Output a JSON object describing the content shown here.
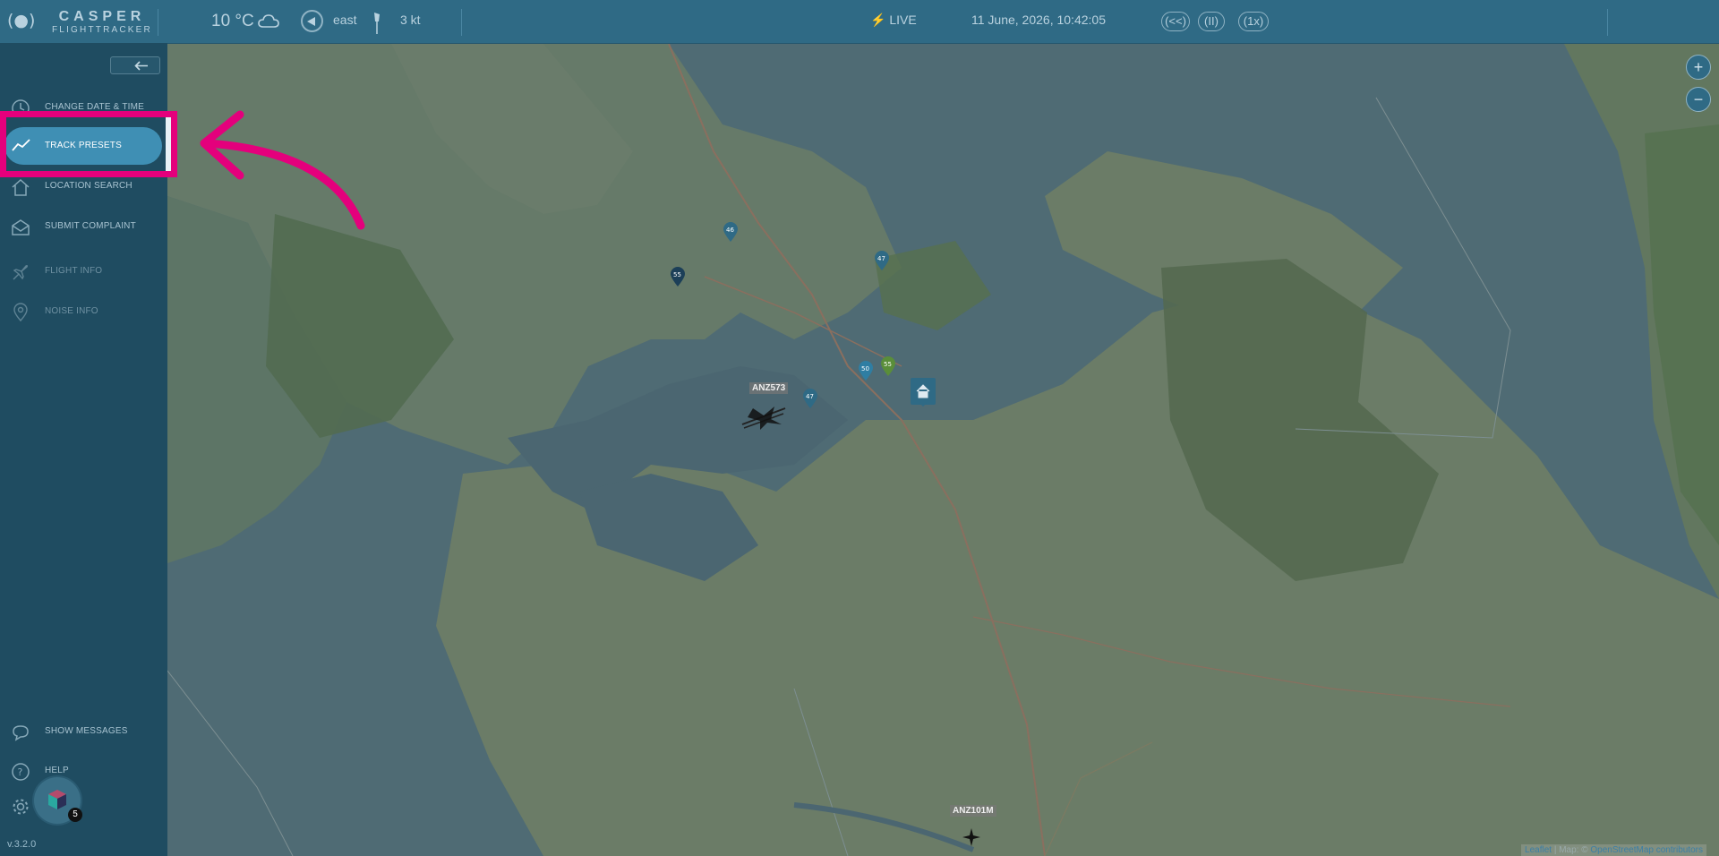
{
  "header": {
    "logo_line1": "CASPER",
    "logo_line2": "FLIGHTTRACKER",
    "temperature": "10 °C",
    "weather_icon": "cloud-icon",
    "wind_direction": "east",
    "wind_speed": "3 kt",
    "live_label": "LIVE",
    "datetime": "11 June, 2026, 10:42:05",
    "rewind_label": "(<<)",
    "pause_label": "(II)",
    "speed_label": "(1x)"
  },
  "sidebar": {
    "items": [
      {
        "label": "CHANGE DATE & TIME",
        "icon": "clock-icon"
      },
      {
        "label": "TRACK PRESETS",
        "icon": "chart-line-icon"
      },
      {
        "label": "LOCATION SEARCH",
        "icon": "home-icon"
      },
      {
        "label": "SUBMIT COMPLAINT",
        "icon": "envelope-icon"
      },
      {
        "label": "FLIGHT INFO",
        "icon": "plane-icon"
      },
      {
        "label": "NOISE INFO",
        "icon": "location-pin-icon"
      }
    ],
    "bottom_items": [
      {
        "label": "SHOW MESSAGES",
        "icon": "chat-bubble-icon"
      },
      {
        "label": "HELP",
        "icon": "help-icon"
      }
    ],
    "settings_icon": "gear-icon",
    "notification_count": "5",
    "version": "v.3.2.0"
  },
  "map": {
    "flights": [
      "ANZ573",
      "ANZ101M"
    ],
    "markers": [
      "46",
      "47",
      "55",
      "50",
      "55",
      "47"
    ],
    "attribution_link": "Leaflet",
    "attribution_text": "| Map: ©",
    "attribution_osm": "OpenStreetMap contributors",
    "zoom_in": "+",
    "zoom_out": "−"
  },
  "colors": {
    "highlight": "#e4007c",
    "topbar": "#2f6a85",
    "sidebar": "#1f4c61",
    "active_item": "#3f8fb4"
  }
}
